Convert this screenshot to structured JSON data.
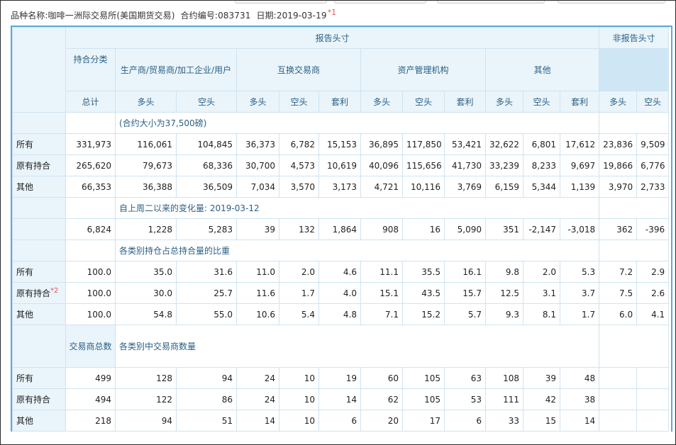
{
  "caption": {
    "commodity_label": "品种名称:",
    "commodity_value": "咖啡一洲际交易所(美国期货交易)",
    "contract_label": "合约编号:",
    "contract_value": "083731",
    "date_label": "日期:",
    "date_value": "2019-03-19",
    "footnote_mark": "*1"
  },
  "headers": {
    "reportable": "报告头寸",
    "nonreportable": "非报告头寸",
    "position_category": "持合分类",
    "producer": "生产商/贸易商/加工企业/用户",
    "swap": "互换交易商",
    "managed": "资产管理机构",
    "other": "其他",
    "total": "总计",
    "long": "多头",
    "short": "空头",
    "spread": "套利"
  },
  "section_notes": {
    "contract_size": "(合约大小为37,500磅)",
    "change": "自上周二以来的变化量: 2019-03-12",
    "share": "各类别持仓占总持合量的比重",
    "traders_total_label": "交易商总数",
    "traders": "各类别中交易商数量"
  },
  "positions": [
    {
      "label": "所有",
      "fn": "",
      "values": [
        "331,973",
        "116,061",
        "104,845",
        "36,373",
        "6,782",
        "15,153",
        "36,895",
        "117,850",
        "53,421",
        "32,622",
        "6,801",
        "17,612",
        "23,836",
        "9,509"
      ]
    },
    {
      "label": "原有持合",
      "fn": "",
      "values": [
        "265,620",
        "79,673",
        "68,336",
        "30,700",
        "4,573",
        "10,619",
        "40,096",
        "115,656",
        "41,730",
        "33,239",
        "8,233",
        "9,697",
        "19,866",
        "6,776"
      ]
    },
    {
      "label": "其他",
      "fn": "",
      "values": [
        "66,353",
        "36,388",
        "36,509",
        "7,034",
        "3,570",
        "3,173",
        "4,721",
        "10,116",
        "3,769",
        "6,159",
        "5,344",
        "1,139",
        "3,970",
        "2,733"
      ]
    }
  ],
  "changes": {
    "label": "",
    "values": [
      "6,824",
      "1,228",
      "5,283",
      "39",
      "132",
      "1,864",
      "908",
      "16",
      "5,090",
      "351",
      "-2,147",
      "-3,018",
      "362",
      "-396"
    ]
  },
  "shares": [
    {
      "label": "所有",
      "fn": "",
      "values": [
        "100.0",
        "35.0",
        "31.6",
        "11.0",
        "2.0",
        "4.6",
        "11.1",
        "35.5",
        "16.1",
        "9.8",
        "2.0",
        "5.3",
        "7.2",
        "2.9"
      ]
    },
    {
      "label": "原有持合",
      "fn": "*2",
      "values": [
        "100.0",
        "30.0",
        "25.7",
        "11.6",
        "1.7",
        "4.0",
        "15.1",
        "43.5",
        "15.7",
        "12.5",
        "3.1",
        "3.7",
        "7.5",
        "2.6"
      ]
    },
    {
      "label": "其他",
      "fn": "",
      "values": [
        "100.0",
        "54.8",
        "55.0",
        "10.6",
        "5.4",
        "4.8",
        "7.1",
        "15.2",
        "5.7",
        "9.3",
        "8.1",
        "1.7",
        "6.0",
        "4.1"
      ]
    }
  ],
  "traders": [
    {
      "label": "所有",
      "values": [
        "499",
        "128",
        "94",
        "24",
        "10",
        "19",
        "60",
        "105",
        "63",
        "108",
        "39",
        "48",
        "",
        ""
      ]
    },
    {
      "label": "原有持合",
      "values": [
        "494",
        "122",
        "86",
        "24",
        "10",
        "14",
        "62",
        "105",
        "53",
        "111",
        "42",
        "38",
        "",
        ""
      ]
    },
    {
      "label": "其他",
      "values": [
        "218",
        "94",
        "51",
        "14",
        "10",
        "6",
        "20",
        "17",
        "6",
        "33",
        "15",
        "14",
        "",
        ""
      ]
    }
  ]
}
